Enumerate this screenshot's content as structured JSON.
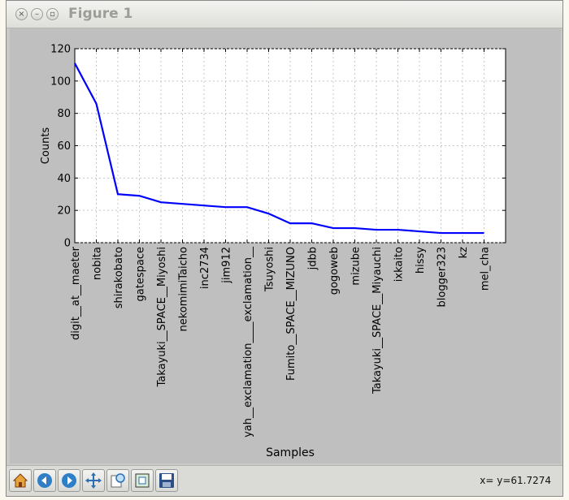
{
  "window": {
    "title": "Figure 1"
  },
  "toolbar": {
    "buttons": [
      "home-icon",
      "back-arrow-icon",
      "forward-arrow-icon",
      "pan-icon",
      "zoom-icon",
      "subplots-icon",
      "save-icon"
    ],
    "status": "x= y=61.7274"
  },
  "chart_data": {
    "type": "line",
    "title": "",
    "xlabel": "Samples",
    "ylabel": "Counts",
    "categories": [
      "digit__at__maeter",
      "nobita",
      "shirakobato",
      "gatespace",
      "Takayuki__SPACE__Miyoshi",
      "nekomimiTaicho",
      "inc2734",
      "jim912",
      "yah__exclamation____exclamation__",
      "Tsuyoshi",
      "Fumito__SPACE__MIZUNO",
      "jdbb",
      "gogoweb",
      "mizube",
      "Takayuki__SPACE__Miyauchi",
      "ixkaito",
      "hissy",
      "blogger323",
      "kz",
      "mel_cha"
    ],
    "values": [
      111,
      86,
      30,
      29,
      25,
      24,
      23,
      22,
      22,
      18,
      12,
      12,
      9,
      9,
      8,
      8,
      7,
      6,
      6,
      6
    ],
    "ylim": [
      0,
      120
    ],
    "yticks": [
      0,
      20,
      40,
      60,
      80,
      100,
      120
    ],
    "grid": true,
    "line_color": "#0000ff"
  }
}
